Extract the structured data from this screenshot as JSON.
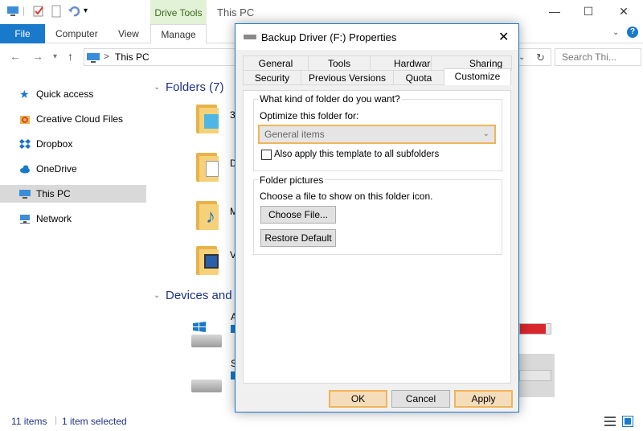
{
  "explorer": {
    "window_title": "This PC",
    "contextual_tab": "Drive Tools",
    "ribbon_tabs": {
      "file": "File",
      "computer": "Computer",
      "view": "View",
      "manage": "Manage"
    },
    "address": "This PC",
    "address_sep": ">",
    "search_placeholder": "Search Thi...",
    "nav_items": [
      "Quick access",
      "Creative Cloud Files",
      "Dropbox",
      "OneDrive",
      "This PC",
      "Network"
    ],
    "groups": {
      "folders": "Folders (7)",
      "devices": "Devices and d"
    },
    "folder_letters": [
      "3",
      "D",
      "M",
      "V"
    ],
    "device_letters": [
      "A",
      "S"
    ],
    "device_fill_fraction": [
      0.85,
      0.0
    ],
    "status": {
      "items": "11 items",
      "selected": "1 item selected"
    }
  },
  "dialog": {
    "title": "Backup Driver (F:) Properties",
    "tabs_row1": [
      "General",
      "Tools",
      "Hardware",
      "Sharing"
    ],
    "tabs_row2": [
      "Security",
      "Previous Versions",
      "Quota",
      "Customize"
    ],
    "folder_kind_group": "What kind of folder do you want?",
    "optimize_label": "Optimize this folder for:",
    "optimize_value": "General items",
    "apply_subfolders_label": "Also apply this template to all subfolders",
    "folder_pictures_group": "Folder pictures",
    "choose_file_text": "Choose a file to show on this folder icon.",
    "choose_file_button": "Choose File...",
    "restore_default_button": "Restore Default",
    "ok_button": "OK",
    "cancel_button": "Cancel",
    "apply_button": "Apply"
  },
  "colors": {
    "accent": "#1979ca",
    "highlight": "#f0b45a",
    "drive_full": "#d9262c"
  }
}
